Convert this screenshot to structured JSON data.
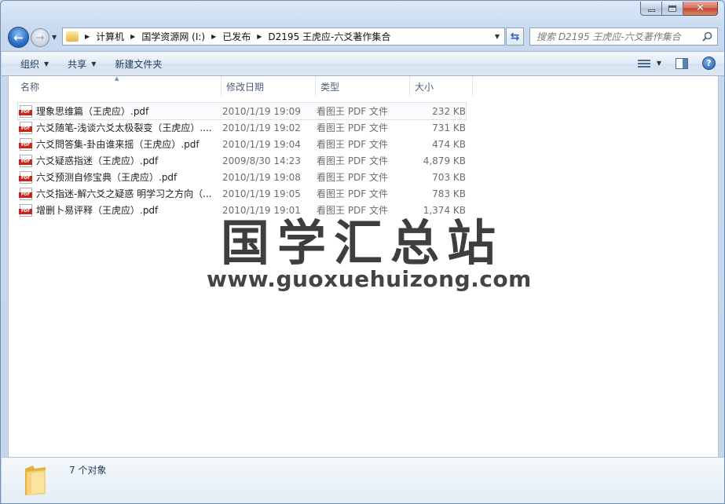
{
  "address": {
    "crumbs": [
      "计算机",
      "国学资源网 (I:)",
      "已发布",
      "D2195 王虎应-六爻著作集合"
    ]
  },
  "search": {
    "placeholder": "搜索 D2195 王虎应-六爻著作集合"
  },
  "toolbar": {
    "organize": "组织",
    "share": "共享",
    "new_folder": "新建文件夹"
  },
  "columns": {
    "name": "名称",
    "date": "修改日期",
    "type": "类型",
    "size": "大小"
  },
  "files": [
    {
      "name": "理象思维篇（王虎应）.pdf",
      "date": "2010/1/19 19:09",
      "type": "看图王 PDF 文件",
      "size": "232 KB"
    },
    {
      "name": "六爻随笔-浅谈六爻太极裂变（王虎应）....",
      "date": "2010/1/19 19:02",
      "type": "看图王 PDF 文件",
      "size": "731 KB"
    },
    {
      "name": "六爻問答集-卦由谁来摇（王虎应）.pdf",
      "date": "2010/1/19 19:04",
      "type": "看图王 PDF 文件",
      "size": "474 KB"
    },
    {
      "name": "六爻疑惑指迷（王虎应）.pdf",
      "date": "2009/8/30 14:23",
      "type": "看图王 PDF 文件",
      "size": "4,879 KB"
    },
    {
      "name": "六爻预测自修宝典（王虎应）.pdf",
      "date": "2010/1/19 19:08",
      "type": "看图王 PDF 文件",
      "size": "703 KB"
    },
    {
      "name": "六爻指迷-解六爻之疑惑  明学习之方向（...",
      "date": "2010/1/19 19:05",
      "type": "看图王 PDF 文件",
      "size": "783 KB"
    },
    {
      "name": "增删卜易评释（王虎应）.pdf",
      "date": "2010/1/19 19:01",
      "type": "看图王 PDF 文件",
      "size": "1,374 KB"
    }
  ],
  "icon_label": "PDF",
  "watermark": {
    "title": "国学汇总站",
    "url": "www.guoxuehuizong.com"
  },
  "status": {
    "count": "7 个对象"
  }
}
